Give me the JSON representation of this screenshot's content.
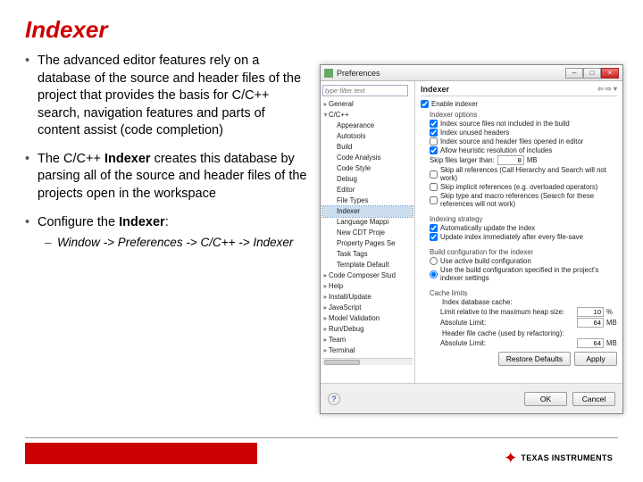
{
  "title": "Indexer",
  "bullets": {
    "b1": "The advanced editor features rely on a database of the source and header files of the project that provides the basis for C/C++ search, navigation features and parts of content assist (code completion)",
    "b2_pre": "The C/C++ ",
    "b2_bold": "Indexer",
    "b2_post": " creates this database by parsing all of the source and header files of the projects open in the workspace",
    "b3_pre": "Configure the ",
    "b3_bold": "Indexer",
    "b3_post": ":",
    "b3_sub": "Window -> Preferences -> C/C++ -> Indexer"
  },
  "dialog": {
    "title": "Preferences",
    "filter_placeholder": "type filter text",
    "section": "Indexer",
    "tree": {
      "general": "General",
      "cpp": "C/C++",
      "items": [
        "Appearance",
        "Autotools",
        "Build",
        "Code Analysis",
        "Code Style",
        "Debug",
        "Editor",
        "File Types",
        "Indexer",
        "Language Mappi",
        "New CDT Proje",
        "Property Pages Se",
        "Task Tags",
        "Template Default"
      ],
      "rest": [
        "Code Composer Stud",
        "Help",
        "Install/Update",
        "JavaScript",
        "Model Validation",
        "Run/Debug",
        "Team",
        "Terminal"
      ]
    },
    "enable": "Enable indexer",
    "opts_label": "Indexer options",
    "opts": [
      {
        "text": "Index source files not included in the build",
        "checked": true
      },
      {
        "text": "Index unused headers",
        "checked": true
      },
      {
        "text": "Index source and header files opened in editor",
        "checked": false
      },
      {
        "text": "Allow heuristic resolution of includes",
        "checked": true
      }
    ],
    "skip_label": "Skip files larger than:",
    "skip_value": "8",
    "skip_unit": "MB",
    "skip_opts": [
      {
        "text": "Skip all references (Call Hierarchy and Search will not work)",
        "checked": false
      },
      {
        "text": "Skip implicit references (e.g. overloaded operators)",
        "checked": false
      },
      {
        "text": "Skip type and macro references (Search for these references will not work)",
        "checked": false
      }
    ],
    "strategy_label": "Indexing strategy",
    "strategy": [
      {
        "text": "Automatically update the index",
        "checked": true
      },
      {
        "text": "Update index immediately after every file-save",
        "checked": true
      }
    ],
    "build_label": "Build configuration for the indexer",
    "build_radios": [
      {
        "text": "Use active build configuration",
        "checked": false
      },
      {
        "text": "Use the build configuration specified in the project's indexer settings",
        "checked": true
      }
    ],
    "cache_label": "Cache limits",
    "cache_db": "Index database cache:",
    "cache_heap_label": "Limit relative to the maximum heap size:",
    "cache_heap_val": "10",
    "cache_heap_unit": "%",
    "cache_abs_label": "Absolute Limit:",
    "cache_abs_val": "64",
    "cache_abs_unit": "MB",
    "cache_hdr": "Header file cache (used by refactoring):",
    "cache_hdr_label": "Absolute Limit:",
    "cache_hdr_val": "64",
    "cache_hdr_unit": "MB",
    "restore": "Restore Defaults",
    "apply": "Apply",
    "ok": "OK",
    "cancel": "Cancel"
  },
  "brand": "TEXAS INSTRUMENTS"
}
